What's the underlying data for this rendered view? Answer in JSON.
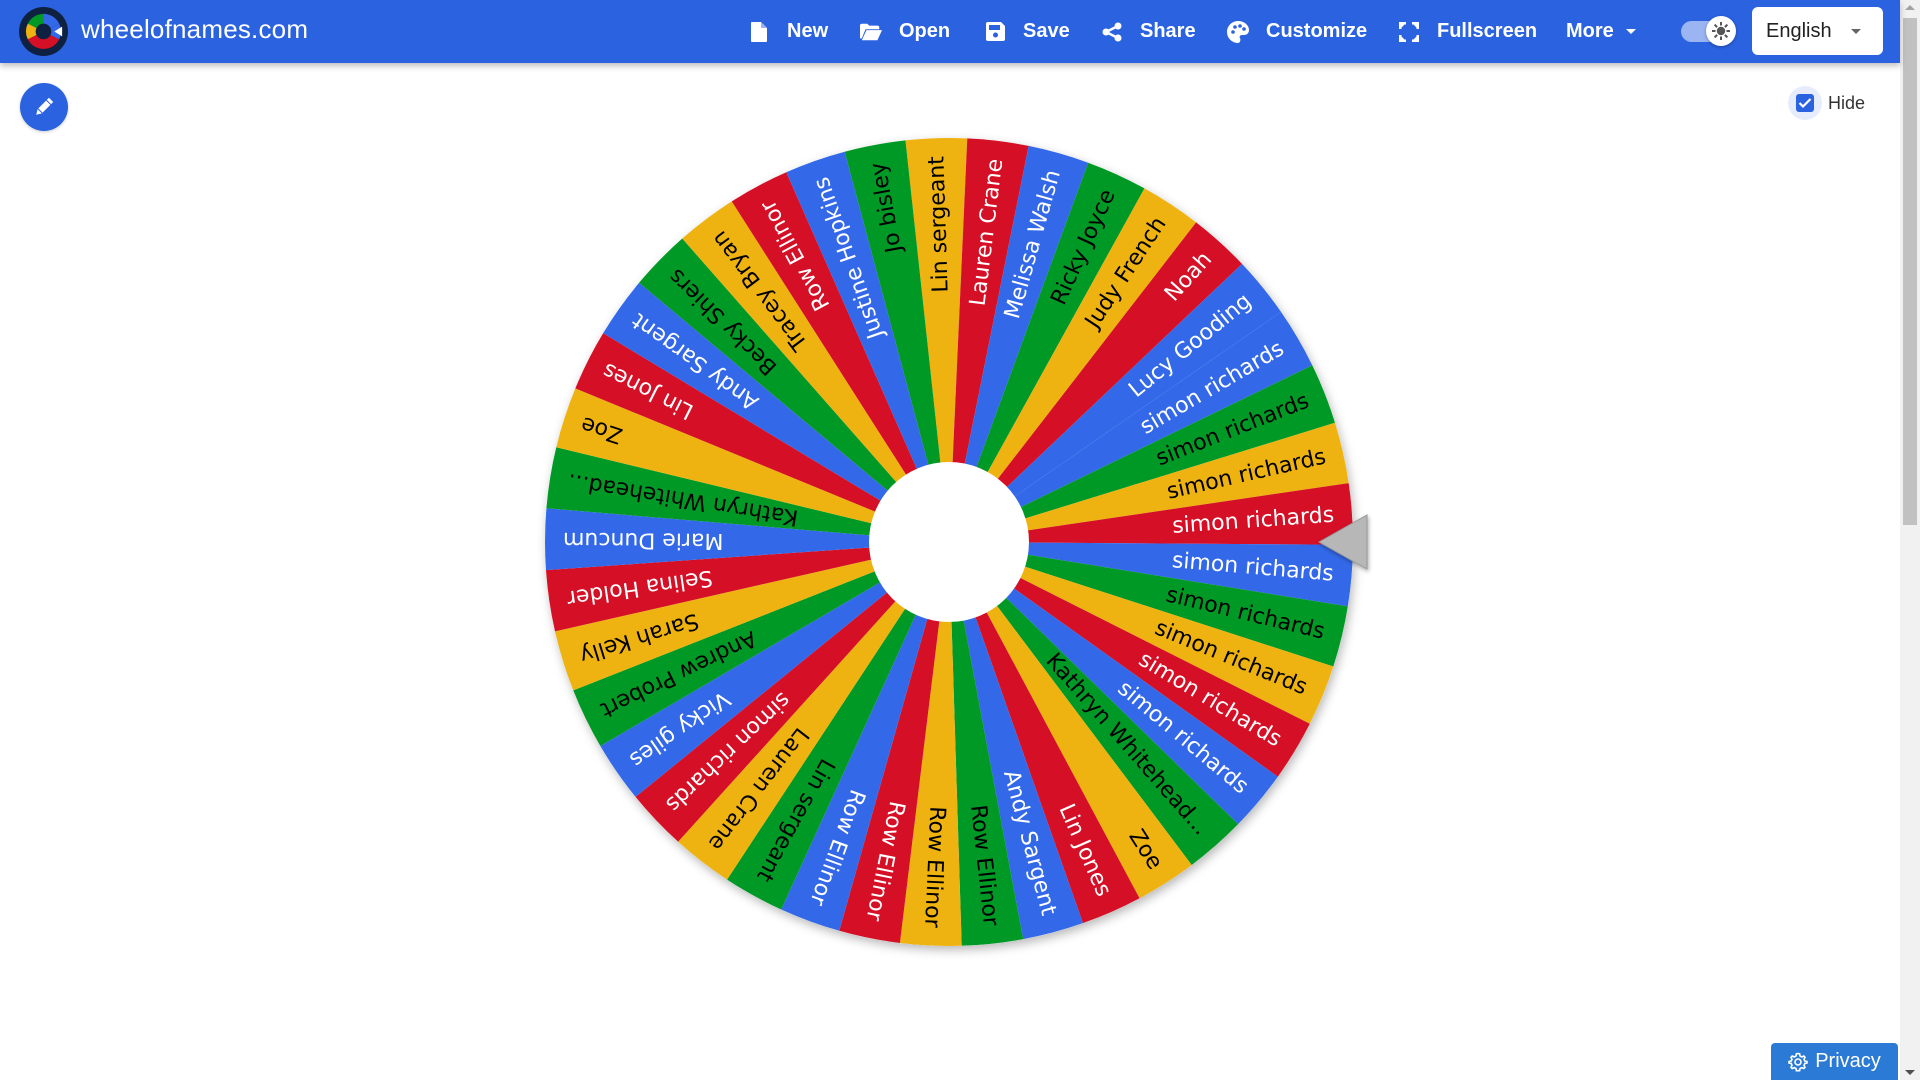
{
  "header": {
    "site_title": "wheelofnames.com",
    "menu": [
      {
        "label": "New",
        "icon": "file-icon"
      },
      {
        "label": "Open",
        "icon": "folder-open-icon"
      },
      {
        "label": "Save",
        "icon": "floppy-disk-icon"
      },
      {
        "label": "Share",
        "icon": "share-icon"
      },
      {
        "label": "Customize",
        "icon": "palette-icon"
      },
      {
        "label": "Fullscreen",
        "icon": "fullscreen-icon"
      },
      {
        "label": "More",
        "icon": "caret-down-icon"
      }
    ],
    "theme_toggle": {
      "icon": "sun-icon",
      "state": "on"
    },
    "language": "English"
  },
  "controls": {
    "edit_icon": "pencil-icon",
    "hide_label": "Hide",
    "hide_checked": true
  },
  "wheel": {
    "colors": {
      "blue": "#3369e8",
      "red": "#d50f25",
      "yellow": "#eeb211",
      "green": "#009925"
    },
    "text_colors": {
      "blue": "#ffffff",
      "red": "#ffffff",
      "yellow": "#000000",
      "green": "#000000"
    },
    "pointer_color": "#b7b7b7",
    "entries": [
      {
        "name": "Lin sergeant",
        "color": "yellow"
      },
      {
        "name": "Lauren Crane",
        "color": "red"
      },
      {
        "name": "Melissa Walsh",
        "color": "blue"
      },
      {
        "name": "Ricky Joyce",
        "color": "green"
      },
      {
        "name": "Judy French",
        "color": "yellow"
      },
      {
        "name": "Noah",
        "color": "red"
      },
      {
        "name": "Lucy Gooding",
        "color": "blue"
      },
      {
        "name": "simon richards",
        "color": "blue"
      },
      {
        "name": "simon richards",
        "color": "green"
      },
      {
        "name": "simon richards",
        "color": "yellow"
      },
      {
        "name": "simon richards",
        "color": "red"
      },
      {
        "name": "simon richards",
        "color": "blue"
      },
      {
        "name": "simon richards",
        "color": "green"
      },
      {
        "name": "simon richards",
        "color": "yellow"
      },
      {
        "name": "simon richards",
        "color": "red"
      },
      {
        "name": "simon richards",
        "color": "blue"
      },
      {
        "name": "Kathryn Whitehead...",
        "color": "green"
      },
      {
        "name": "Zoe",
        "color": "yellow"
      },
      {
        "name": "Lin Jones",
        "color": "red"
      },
      {
        "name": "Andy Sargent",
        "color": "blue"
      },
      {
        "name": "Row Ellinor",
        "color": "green"
      },
      {
        "name": "Row Ellinor",
        "color": "yellow"
      },
      {
        "name": "Row Ellinor",
        "color": "red"
      },
      {
        "name": "Row Ellinor",
        "color": "blue"
      },
      {
        "name": "Lin sergeant",
        "color": "green"
      },
      {
        "name": "Lauren Crane",
        "color": "yellow"
      },
      {
        "name": "simon richards",
        "color": "red"
      },
      {
        "name": "Vicky giles",
        "color": "blue"
      },
      {
        "name": "Andrew Probert",
        "color": "green"
      },
      {
        "name": "Sarah Kelly",
        "color": "yellow"
      },
      {
        "name": "Selina Holder",
        "color": "red"
      },
      {
        "name": "Marie Duncum",
        "color": "blue"
      },
      {
        "name": "Kathryn Whitehead...",
        "color": "green"
      },
      {
        "name": "Zoe",
        "color": "yellow"
      },
      {
        "name": "Lin Jones",
        "color": "red"
      },
      {
        "name": "Andy Sargent",
        "color": "blue"
      },
      {
        "name": "Becky Shiers",
        "color": "green"
      },
      {
        "name": "Tracey Bryan",
        "color": "yellow"
      },
      {
        "name": "Row Ellinor",
        "color": "red"
      },
      {
        "name": "Justine Hopkins",
        "color": "blue"
      },
      {
        "name": "Jo bisley",
        "color": "green"
      }
    ]
  },
  "footer": {
    "privacy_label": "Privacy",
    "privacy_icon": "gear-icon"
  }
}
